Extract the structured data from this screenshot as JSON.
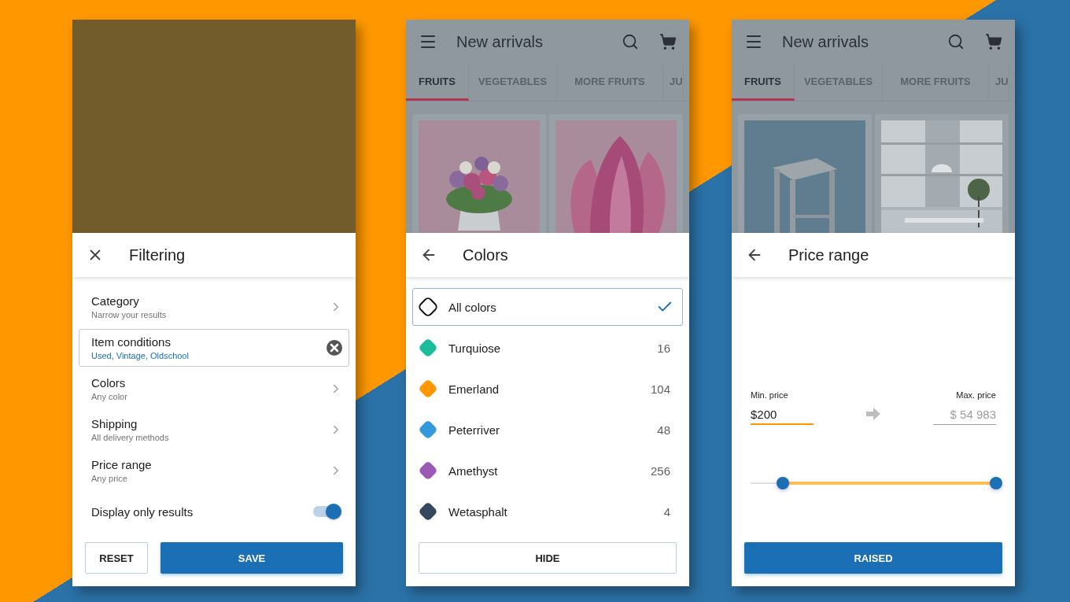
{
  "panels": [
    {
      "kind": "filtering",
      "header": {
        "kind": "close",
        "title": "Filtering"
      },
      "items": [
        {
          "kind": "nav",
          "title": "Category",
          "subtitle": "Narrow your results",
          "selected": false
        },
        {
          "kind": "clearable",
          "title": "Item conditions",
          "subtitle": "Used, Vintage, Oldschool",
          "selected": true
        },
        {
          "kind": "nav",
          "title": "Colors",
          "subtitle": "Any color",
          "selected": false
        },
        {
          "kind": "nav",
          "title": "Shipping",
          "subtitle": "All delivery methods",
          "selected": false
        },
        {
          "kind": "nav",
          "title": "Price range",
          "subtitle": "Any price",
          "selected": false
        },
        {
          "kind": "switch",
          "title": "Display only results",
          "on": true,
          "selected": false
        }
      ],
      "buttons": [
        {
          "kind": "outlined",
          "label": "RESET"
        },
        {
          "kind": "filled",
          "label": "SAVE"
        }
      ]
    },
    {
      "kind": "colors",
      "app_bar": {
        "title": "New arrivals",
        "tabs": [
          {
            "label": "FRUITS",
            "selected": true
          },
          {
            "label": "VEGETABLES",
            "selected": false
          },
          {
            "label": "MORE FRUITS",
            "selected": false
          },
          {
            "label": "JU",
            "selected": false
          }
        ]
      },
      "header": {
        "kind": "back",
        "title": "Colors"
      },
      "items": [
        {
          "kind": "all",
          "name": "All colors",
          "selected": true
        },
        {
          "kind": "swatch",
          "name": "Turquiose",
          "count": "16",
          "color": "#1abc9c",
          "selected": false
        },
        {
          "kind": "swatch",
          "name": "Emerland",
          "count": "104",
          "color": "#ff9800",
          "selected": false
        },
        {
          "kind": "swatch",
          "name": "Peterriver",
          "count": "48",
          "color": "#3498db",
          "selected": false
        },
        {
          "kind": "swatch",
          "name": "Amethyst",
          "count": "256",
          "color": "#9b59b6",
          "selected": false
        },
        {
          "kind": "swatch",
          "name": "Wetasphalt",
          "count": "4",
          "color": "#34495e",
          "selected": false
        }
      ],
      "buttons": [
        {
          "kind": "outlined",
          "label": "HIDE"
        }
      ]
    },
    {
      "kind": "price",
      "app_bar": {
        "title": "New arrivals",
        "tabs": [
          {
            "label": "FRUITS",
            "selected": true
          },
          {
            "label": "VEGETABLES",
            "selected": false
          },
          {
            "label": "MORE FRUITS",
            "selected": false
          },
          {
            "label": "JU",
            "selected": false
          }
        ]
      },
      "header": {
        "kind": "back",
        "title": "Price range"
      },
      "min": {
        "label": "Min. price",
        "value": "$200",
        "focused": true
      },
      "max": {
        "label": "Max. price",
        "placeholder": "$ 54 983",
        "focused": false
      },
      "slider": {
        "thumbs": [
          {
            "level": 0.13
          },
          {
            "level": 1
          }
        ]
      },
      "buttons": [
        {
          "kind": "filled",
          "label": "RAISED"
        }
      ]
    }
  ]
}
